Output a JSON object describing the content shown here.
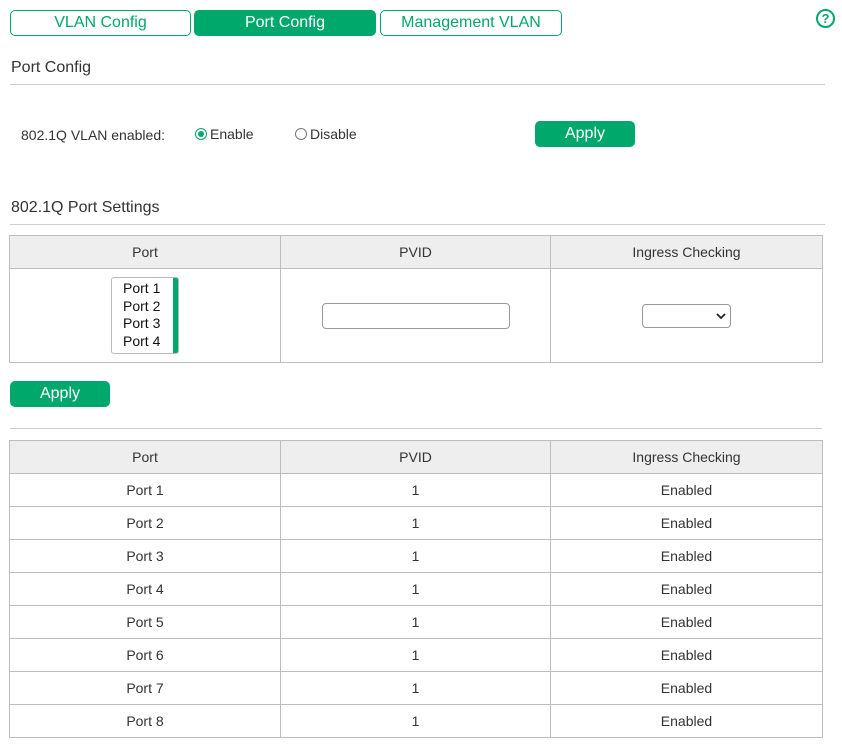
{
  "tabs": [
    {
      "label": "VLAN Config",
      "active": false
    },
    {
      "label": "Port Config",
      "active": true
    },
    {
      "label": "Management VLAN",
      "active": false
    }
  ],
  "help_glyph": "?",
  "port_config": {
    "title": "Port Config",
    "vlan_label": "802.1Q VLAN enabled:",
    "enable_label": "Enable",
    "disable_label": "Disable",
    "selected": "Enable",
    "apply_label": "Apply"
  },
  "port_settings": {
    "title": "802.1Q Port Settings",
    "headers": [
      "Port",
      "PVID",
      "Ingress Checking"
    ],
    "port_options": [
      "Port 1",
      "Port 2",
      "Port 3",
      "Port 4"
    ],
    "pvid_value": "",
    "ingress_value": "",
    "apply_label": "Apply"
  },
  "status_table": {
    "headers": [
      "Port",
      "PVID",
      "Ingress Checking"
    ],
    "rows": [
      [
        "Port 1",
        "1",
        "Enabled"
      ],
      [
        "Port 2",
        "1",
        "Enabled"
      ],
      [
        "Port 3",
        "1",
        "Enabled"
      ],
      [
        "Port 4",
        "1",
        "Enabled"
      ],
      [
        "Port 5",
        "1",
        "Enabled"
      ],
      [
        "Port 6",
        "1",
        "Enabled"
      ],
      [
        "Port 7",
        "1",
        "Enabled"
      ],
      [
        "Port 8",
        "1",
        "Enabled"
      ]
    ]
  },
  "colors": {
    "accent": "#00a86b",
    "header_bg": "#eeeeee",
    "border": "#bdbdbd"
  }
}
